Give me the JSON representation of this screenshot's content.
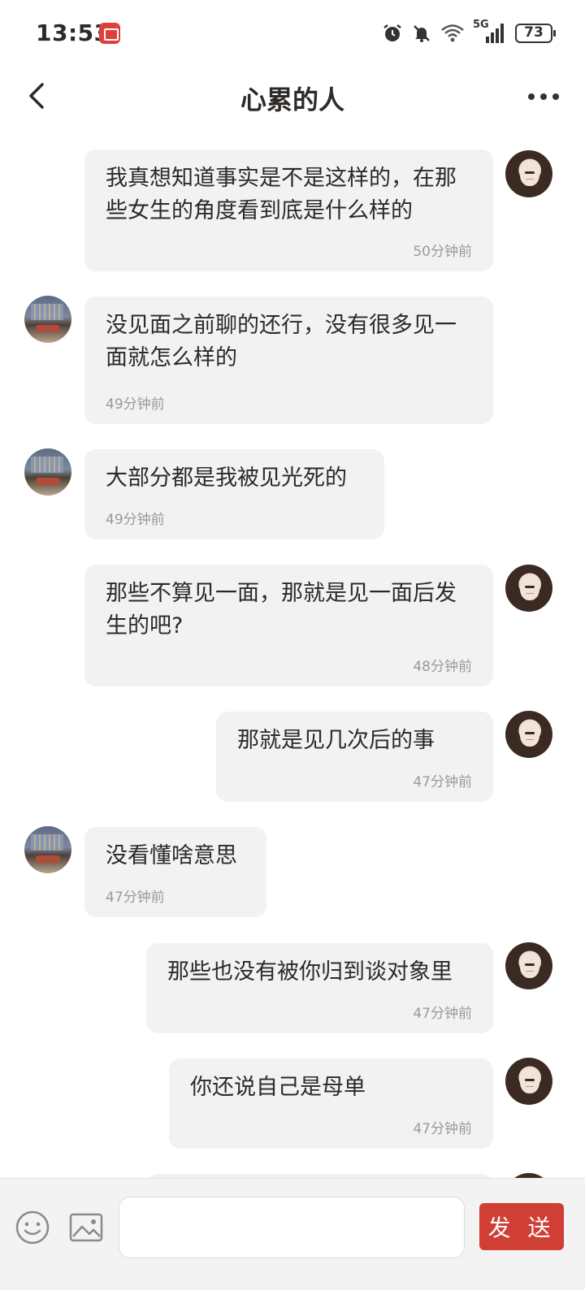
{
  "status_bar": {
    "time": "13:53",
    "battery": "73",
    "network_label": "5G",
    "icons": [
      "alarm-icon",
      "mute-icon",
      "wifi-icon",
      "signal-icon",
      "battery-icon"
    ]
  },
  "header": {
    "title": "心累的人",
    "back_icon": "chevron-left-icon",
    "more_icon": "more-horizontal-icon"
  },
  "messages": [
    {
      "sender": "me",
      "text": "我真想知道事实是不是这样的，在那些女生的角度看到底是什么样的",
      "time": "50分钟前"
    },
    {
      "sender": "other",
      "text": "没见面之前聊的还行，没有很多见一面就怎么样的",
      "time": "49分钟前"
    },
    {
      "sender": "other",
      "text": "大部分都是我被见光死的",
      "time": "49分钟前"
    },
    {
      "sender": "me",
      "text": "那些不算见一面，那就是见一面后发生的吧?",
      "time": "48分钟前"
    },
    {
      "sender": "me",
      "text": "那就是见几次后的事",
      "time": "47分钟前"
    },
    {
      "sender": "other",
      "text": "没看懂啥意思",
      "time": "47分钟前"
    },
    {
      "sender": "me",
      "text": "那些也没有被你归到谈对象里",
      "time": "47分钟前"
    },
    {
      "sender": "me",
      "text": "你还说自己是母单",
      "time": "47分钟前"
    }
  ],
  "input_bar": {
    "emoji_icon": "emoji-icon",
    "image_icon": "image-icon",
    "input_value": "",
    "send_label": "发 送"
  },
  "colors": {
    "accent": "#cf3f35",
    "bubble": "#f2f2f2",
    "timestamp": "#9a9a9a"
  }
}
